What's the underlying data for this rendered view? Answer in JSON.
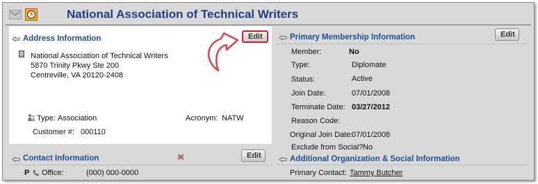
{
  "title": "National Association of Technical Writers",
  "address": {
    "header": "Address Information",
    "edit_label": "Edit",
    "lines": [
      "National Association of Technical Writers",
      "5870 Trinity Pkwy Ste 200",
      "Centreville, VA 20120-2408"
    ],
    "type_label": "Type:",
    "type_value": "Association",
    "acronym_label": "Acronym:",
    "acronym_value": "NATW",
    "customer_label": "Customer #:",
    "customer_value": "000110"
  },
  "contact": {
    "header": "Contact Information",
    "edit_label": "Edit",
    "phone_prefix": "P",
    "office_label": "Office:",
    "office_value": "(000) 000-0000"
  },
  "membership": {
    "header": "Primary Membership Information",
    "edit_label": "Edit",
    "rows": [
      {
        "label": "Member:",
        "value": "No"
      },
      {
        "label": "Type:",
        "value": "Diplomate"
      },
      {
        "label": "Status:",
        "value": "Active"
      },
      {
        "label": "Join Date:",
        "value": "07/01/2008"
      },
      {
        "label": "Terminate Date:",
        "value": "03/27/2012"
      },
      {
        "label": "Reason Code:",
        "value": ""
      },
      {
        "label": "Original Join Date:",
        "value": "07/01/2008"
      },
      {
        "label": "Exclude from Social?",
        "value": "No"
      }
    ]
  },
  "additional": {
    "header": "Additional Organization & Social Information",
    "primary_contact_label": "Primary Contact:",
    "primary_contact_value": "Tammy Butcher"
  },
  "colors": {
    "accent": "#1f4f96",
    "title": "#1f3f86",
    "highlight": "#d21f2a",
    "arrow": "#e0404a"
  }
}
